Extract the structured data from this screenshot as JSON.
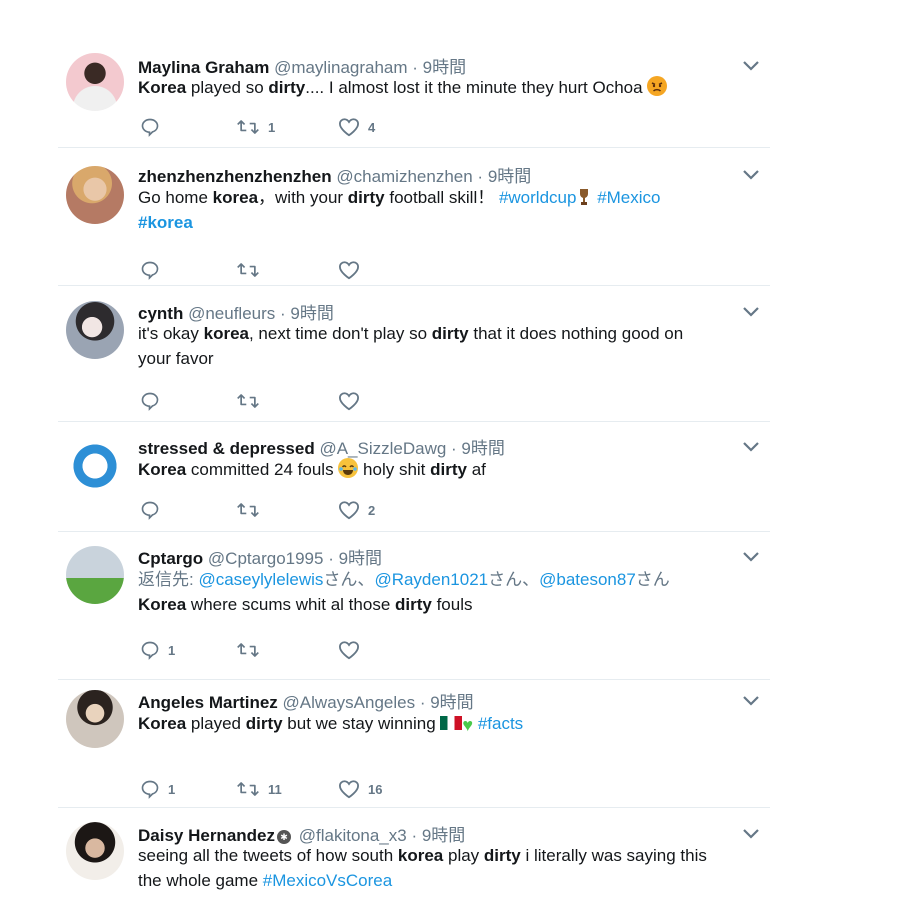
{
  "tweets": [
    {
      "name": "Maylina Graham",
      "handle": "@maylinagraham",
      "time": "9時間",
      "text_parts": [
        {
          "t": "Korea",
          "b": true
        },
        {
          "t": " played so "
        },
        {
          "t": "dirty",
          "b": true
        },
        {
          "t": ".... I almost lost it the minute they hurt Ochoa "
        }
      ],
      "emoji_trailing": "angry-face",
      "replies": "",
      "retweets": "1",
      "likes": "4"
    },
    {
      "name": "zhenzhenzhenzhenzhen",
      "handle": "@chamizhenzhen",
      "time": "9時間",
      "text_parts": [
        {
          "t": "Go home "
        },
        {
          "t": "korea",
          "b": true
        },
        {
          "t": "，with your "
        },
        {
          "t": "dirty",
          "b": true
        },
        {
          "t": " football skill！ "
        },
        {
          "t": "#worldcup",
          "tag": true
        },
        {
          "t": " "
        },
        {
          "t": "#Mexico",
          "tag": true
        }
      ],
      "text_line2": "#korea",
      "replies": "",
      "retweets": "",
      "likes": ""
    },
    {
      "name": "cynth",
      "handle": "@neufleurs",
      "time": "9時間",
      "text_parts": [
        {
          "t": "it's okay "
        },
        {
          "t": "korea",
          "b": true
        },
        {
          "t": ", next time don't play so "
        },
        {
          "t": "dirty",
          "b": true
        },
        {
          "t": " that it does nothing good on"
        }
      ],
      "text_line2": "your favor",
      "replies": "",
      "retweets": "",
      "likes": ""
    },
    {
      "name": "stressed & depressed",
      "handle": "@A_SizzleDawg",
      "time": "9時間",
      "text_parts": [
        {
          "t": "Korea",
          "b": true
        },
        {
          "t": " committed 24 fouls "
        }
      ],
      "emoji_middle": "tears-of-joy",
      "text_after": [
        {
          "t": " holy shit "
        },
        {
          "t": "dirty",
          "b": true
        },
        {
          "t": " af"
        }
      ],
      "replies": "",
      "retweets": "",
      "likes": "2"
    },
    {
      "name": "Cptargo",
      "handle": "@Cptargo1995",
      "time": "9時間",
      "reply_prefix": "返信先:",
      "reply_to": [
        {
          "h": "@caseylylelewis",
          "suffix": "さん、"
        },
        {
          "h": "@Rayden1021",
          "suffix": "さん、"
        },
        {
          "h": "@bateson87",
          "suffix": "さん"
        }
      ],
      "text_parts": [
        {
          "t": "Korea",
          "b": true
        },
        {
          "t": " where scums whit al those "
        },
        {
          "t": "dirty",
          "b": true
        },
        {
          "t": " fouls"
        }
      ],
      "replies": "1",
      "retweets": "",
      "likes": ""
    },
    {
      "name": "Angeles Martinez",
      "handle": "@AlwaysAngeles",
      "time": "9時間",
      "text_parts": [
        {
          "t": "Korea",
          "b": true
        },
        {
          "t": " played "
        },
        {
          "t": "dirty",
          "b": true
        },
        {
          "t": " but we stay winning "
        }
      ],
      "tag_trailing": "#facts",
      "replies": "1",
      "retweets": "11",
      "likes": "16"
    },
    {
      "name": "Daisy Hernandez",
      "handle": "@flakitona_x3",
      "time": "9時間",
      "text_parts": [
        {
          "t": "seeing all the tweets of how south "
        },
        {
          "t": "korea",
          "b": true
        },
        {
          "t": " play "
        },
        {
          "t": "dirty",
          "b": true
        },
        {
          "t": " i literally was saying this"
        }
      ],
      "text_line2": "the whole game ",
      "tag_line2": "#MexicoVsCorea",
      "replies": "",
      "retweets": "",
      "likes": ""
    }
  ],
  "icons": {
    "reply": "reply-icon",
    "retweet": "retweet-icon",
    "like": "heart-icon",
    "more": "chevron-down-icon"
  },
  "colors": {
    "link": "#1b95e0",
    "muted": "#657786",
    "divider": "#e6ecf0"
  }
}
